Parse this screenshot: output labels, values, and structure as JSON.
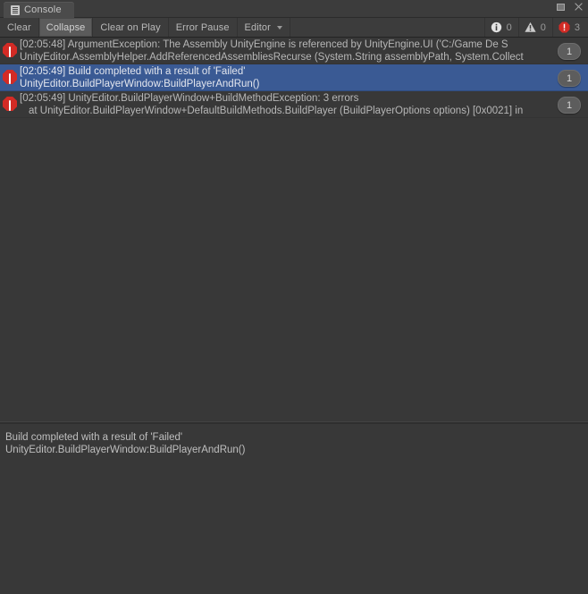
{
  "window": {
    "tab_label": "Console",
    "tab_icon": "console-icon",
    "controls": [
      {
        "name": "maximize-button",
        "icon": "maximize-icon"
      },
      {
        "name": "close-button",
        "icon": "close-icon"
      }
    ]
  },
  "toolbar": {
    "buttons": [
      {
        "label": "Clear",
        "active": false,
        "dropdown": false
      },
      {
        "label": "Collapse",
        "active": true,
        "dropdown": false
      },
      {
        "label": "Clear on Play",
        "active": false,
        "dropdown": false
      },
      {
        "label": "Error Pause",
        "active": false,
        "dropdown": false
      },
      {
        "label": "Editor",
        "active": false,
        "dropdown": true
      }
    ],
    "counters": [
      {
        "type": "info",
        "icon": "info-icon",
        "count": "0"
      },
      {
        "type": "warning",
        "icon": "warning-icon",
        "count": "0"
      },
      {
        "type": "error",
        "icon": "error-icon",
        "count": "3"
      }
    ]
  },
  "log": {
    "entries": [
      {
        "icon": "error-icon",
        "selected": false,
        "line1": "[02:05:48] ArgumentException: The Assembly UnityEngine is referenced by UnityEngine.UI ('C:/Game De S",
        "line2": "UnityEditor.AssemblyHelper.AddReferencedAssembliesRecurse (System.String assemblyPath, System.Collect",
        "indent": false,
        "count": "1"
      },
      {
        "icon": "error-icon",
        "selected": true,
        "line1": "[02:05:49] Build completed with a result of 'Failed'",
        "line2": "UnityEditor.BuildPlayerWindow:BuildPlayerAndRun()",
        "indent": false,
        "count": "1"
      },
      {
        "icon": "error-icon",
        "selected": false,
        "line1": "[02:05:49] UnityEditor.BuildPlayerWindow+BuildMethodException: 3 errors",
        "line2": "at UnityEditor.BuildPlayerWindow+DefaultBuildMethods.BuildPlayer (BuildPlayerOptions options) [0x0021] in",
        "indent": true,
        "count": "1"
      }
    ]
  },
  "details": {
    "lines": [
      "Build completed with a result of 'Failed'",
      "UnityEditor.BuildPlayerWindow:BuildPlayerAndRun()"
    ]
  },
  "colors": {
    "background": "#383838",
    "chrome": "#3c3c3c",
    "selection": "#3a5a94",
    "error": "#d32b25",
    "text": "#b7b7b7"
  }
}
